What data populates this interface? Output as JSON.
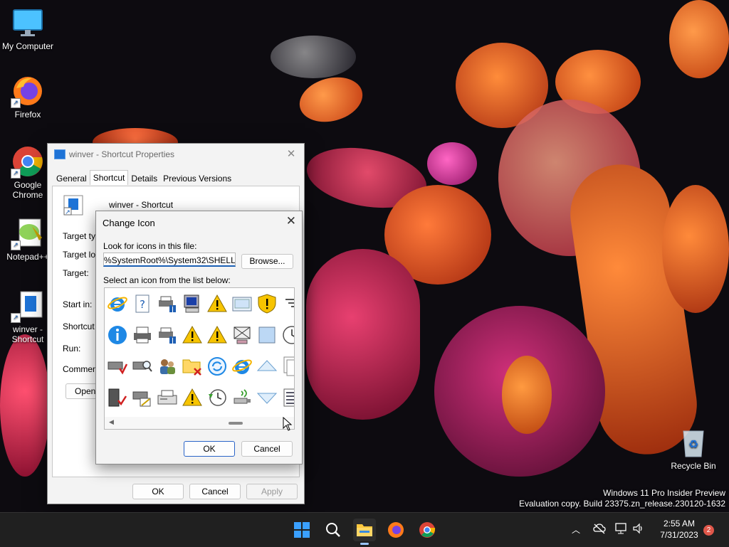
{
  "desktop": {
    "icons": [
      {
        "label": "My Computer"
      },
      {
        "label": "Firefox"
      },
      {
        "label": "Google Chrome"
      },
      {
        "label": "Notepad++"
      },
      {
        "label": "winver - Shortcut"
      },
      {
        "label": "Recycle Bin"
      }
    ],
    "watermark": {
      "line1": "Windows 11 Pro Insider Preview",
      "line2": "Evaluation copy. Build 23375.zn_release.230120-1632"
    }
  },
  "properties_window": {
    "title": "winver - Shortcut Properties",
    "tabs": [
      "General",
      "Shortcut",
      "Details",
      "Previous Versions"
    ],
    "active_tab": "Shortcut",
    "shortcut_name": "winver - Shortcut",
    "labels": {
      "target_type": "Target type:",
      "target_location": "Target location:",
      "target": "Target:",
      "start_in": "Start in:",
      "shortcut_key": "Shortcut key:",
      "run": "Run:",
      "comment": "Comment:"
    },
    "open_button": "Open File Location",
    "buttons": {
      "ok": "OK",
      "cancel": "Cancel",
      "apply": "Apply"
    }
  },
  "change_icon_dialog": {
    "title": "Change Icon",
    "look_label": "Look for icons in this file:",
    "file_value": "%SystemRoot%\\System32\\SHELL32.dll",
    "browse_button": "Browse...",
    "list_label": "Select an icon from the list below:",
    "icons": [
      [
        "ie-icon",
        "help-doc-icon",
        "printer-network-icon",
        "computer-icon",
        "warning-icon",
        "window-icon",
        "shield-warning-icon",
        "list-icon"
      ],
      [
        "info-icon",
        "printer-icon",
        "printer-network-icon",
        "warning-icon",
        "warning-icon",
        "network-folder-icon",
        "square-icon",
        "clock-icon"
      ],
      [
        "drive-check-icon",
        "drive-search-icon",
        "users-icon",
        "folder-x-icon",
        "refresh-icon",
        "ie-icon",
        "triangle-up-icon",
        "pages-icon"
      ],
      [
        "server-icon",
        "drive-edit-icon",
        "fax-icon",
        "warning-icon",
        "clock-restore-icon",
        "usb-icon",
        "triangle-down-icon",
        "document-list-icon"
      ]
    ],
    "buttons": {
      "ok": "OK",
      "cancel": "Cancel"
    }
  },
  "taskbar": {
    "apps": [
      "start-icon",
      "search-icon",
      "file-explorer-icon",
      "firefox-icon",
      "chrome-icon"
    ],
    "time": "2:55 AM",
    "date": "7/31/2023",
    "notification_count": "2"
  }
}
